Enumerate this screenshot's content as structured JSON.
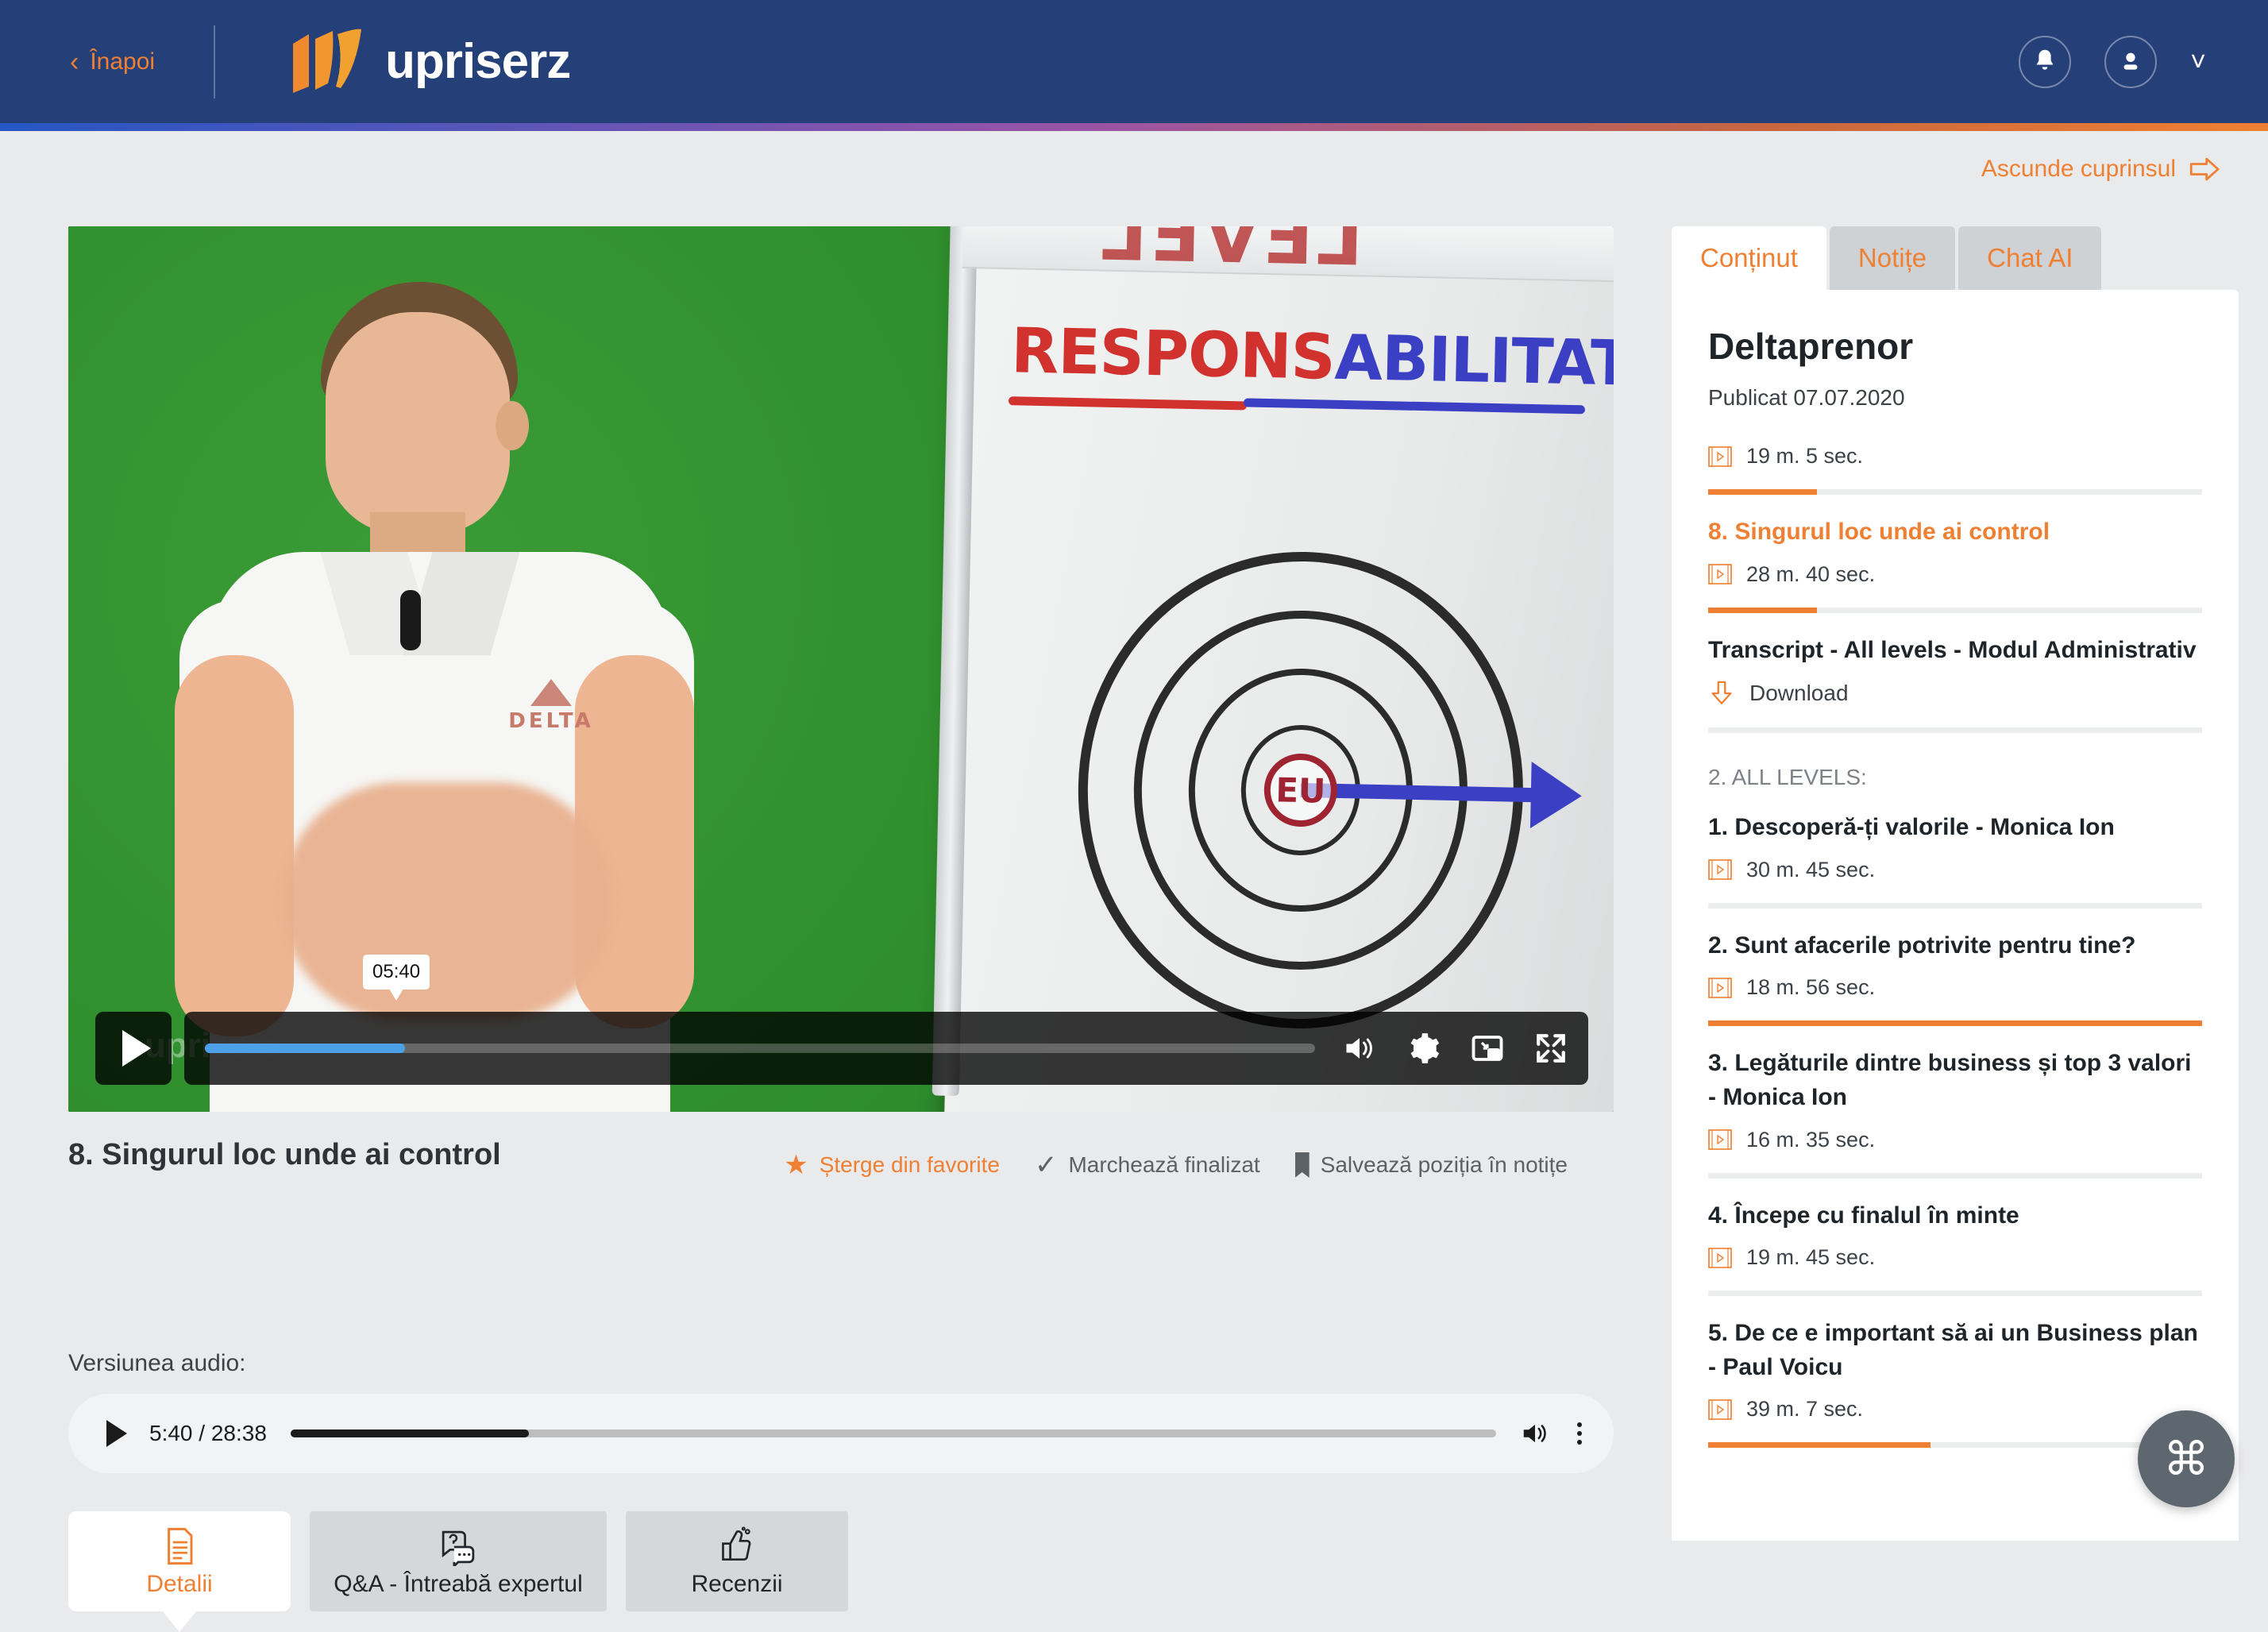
{
  "header": {
    "back_label": "Înapoi",
    "logo_text": "upriserz",
    "notifications_icon": "bell-icon",
    "account_icon": "user-icon",
    "chevron_icon": "chevron-down-icon"
  },
  "colors": {
    "header_bg": "#253f79",
    "accent": "#ef8033",
    "page_bg": "#e9eaec",
    "panel_bg": "#ffffff",
    "tab_inactive_bg": "#cfd2d5"
  },
  "video": {
    "whiteboard_prev_text": "LEVEL",
    "whiteboard_title_red": "RESPONS",
    "whiteboard_title_blue": "ABILITATE",
    "bullseye_label": "EU",
    "watermark": "upriserz",
    "tooltip_time": "05:40",
    "progress_percent": 18,
    "controls": {
      "play_icon": "play-icon",
      "volume_icon": "volume-icon",
      "settings_icon": "gear-icon",
      "miniplayer_icon": "miniplayer-icon",
      "fullscreen_icon": "fullscreen-icon"
    }
  },
  "lesson": {
    "title": "8. Singurul loc unde ai control",
    "actions": [
      {
        "label": "Șterge din favorite",
        "icon": "star-icon",
        "active": true
      },
      {
        "label": "Marchează finalizat",
        "icon": "check-icon",
        "active": false
      },
      {
        "label": "Salvează poziția în notițe",
        "icon": "bookmark-icon",
        "active": false
      }
    ]
  },
  "audio": {
    "label": "Versiunea audio:",
    "current_time": "5:40",
    "duration": "28:38",
    "time_display": "5:40 / 28:38",
    "progress_percent": 19.8,
    "play_icon": "play-icon",
    "volume_icon": "volume-icon",
    "more_icon": "kebab-menu-icon"
  },
  "bottom_tabs": [
    {
      "label": "Detalii",
      "icon": "document-icon",
      "active": true
    },
    {
      "label": "Q&A - Întreabă expertul",
      "icon": "question-bubble-icon",
      "active": false
    },
    {
      "label": "Recenzii",
      "icon": "thumbs-up-icon",
      "active": false
    }
  ],
  "sidebar": {
    "hide_toc_label": "Ascunde cuprinsul",
    "hide_toc_icon": "arrow-right-icon",
    "tabs": [
      {
        "label": "Conținut",
        "active": true
      },
      {
        "label": "Notițe",
        "active": false
      },
      {
        "label": "Chat AI",
        "active": false
      }
    ],
    "course_title": "Deltaprenor",
    "published": "Publicat 07.07.2020",
    "items": [
      {
        "kind": "duration-only",
        "title": "",
        "duration": "19 m. 5 sec.",
        "progress": 22,
        "current": false
      },
      {
        "kind": "lesson",
        "title": "8. Singurul loc unde ai control",
        "duration": "28 m. 40 sec.",
        "progress": 22,
        "current": true
      },
      {
        "kind": "download",
        "title": "Transcript - All levels - Modul Administrativ",
        "download_label": "Download",
        "progress": 0,
        "current": false
      },
      {
        "kind": "section",
        "title": "2. ALL LEVELS:"
      },
      {
        "kind": "lesson",
        "title": "1. Descoperă-ți valorile - Monica Ion",
        "duration": "30 m. 45 sec.",
        "progress": 0,
        "current": false
      },
      {
        "kind": "lesson",
        "title": "2. Sunt afacerile potrivite pentru tine?",
        "duration": "18 m. 56 sec.",
        "progress": 100,
        "current": false
      },
      {
        "kind": "lesson",
        "title": "3. Legăturile dintre business și top 3 valori - Monica Ion",
        "duration": "16 m. 35 sec.",
        "progress": 0,
        "current": false
      },
      {
        "kind": "lesson",
        "title": "4. Începe cu finalul în minte",
        "duration": "19 m. 45 sec.",
        "progress": 0,
        "current": false
      },
      {
        "kind": "lesson",
        "title": "5. De ce e important să ai un Business plan - Paul Voicu",
        "duration": "39 m. 7 sec.",
        "progress": 45,
        "current": false
      }
    ]
  },
  "fab": {
    "icon": "command-icon",
    "glyph": "⌘"
  }
}
